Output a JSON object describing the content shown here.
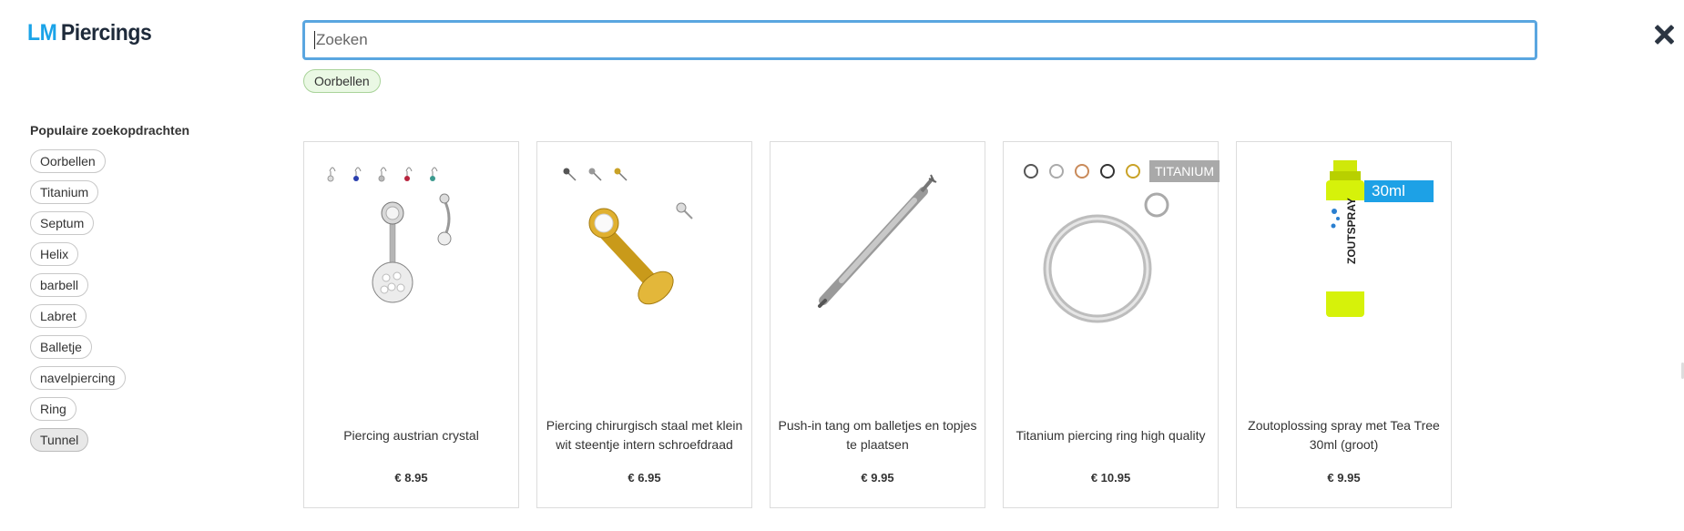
{
  "logo": {
    "part1": "LM",
    "part2": "Piercings"
  },
  "search": {
    "placeholder": "Zoeken",
    "value": ""
  },
  "active_filter": "Oorbellen",
  "popular": {
    "title": "Populaire zoekopdrachten",
    "items": [
      "Oorbellen",
      "Titanium",
      "Septum",
      "Helix",
      "barbell",
      "Labret",
      "Balletje",
      "navelpiercing",
      "Ring",
      "Tunnel"
    ]
  },
  "products": [
    {
      "name": "Piercing austrian crystal",
      "price": "€ 8.95",
      "image": "belly-piercing-image"
    },
    {
      "name": "Piercing chirurgisch staal met klein wit steentje intern schroefdraad",
      "price": "€ 6.95",
      "image": "labret-stud-image"
    },
    {
      "name": "Push-in tang om balletjes en topjes te plaatsen",
      "price": "€ 9.95",
      "image": "tool-image"
    },
    {
      "name": "Titanium piercing ring high quality",
      "price": "€ 10.95",
      "badge": "TITANIUM",
      "image": "ring-image"
    },
    {
      "name": "Zoutoplossing spray met Tea Tree 30ml (groot)",
      "price": "€ 9.95",
      "badge": "30ml",
      "bottle_label": "ZOUTSPRAY",
      "image": "spray-bottle-image"
    }
  ],
  "colors": {
    "accent": "#1aa3e8",
    "search_border": "#5aa6e0",
    "chip_active_bg": "#eaf8e4",
    "badge_gray": "#a9a9a9",
    "spray_green": "#d6f20a"
  }
}
